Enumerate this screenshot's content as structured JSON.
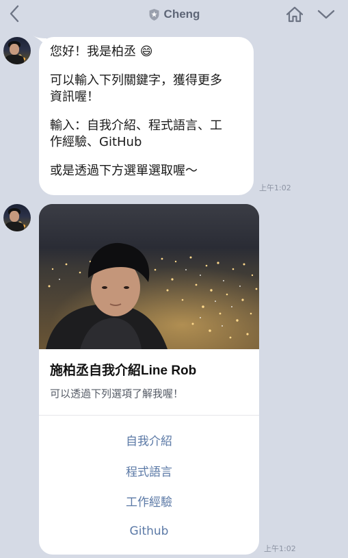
{
  "header": {
    "title": "Cheng",
    "back_icon": "chevron-left-icon",
    "badge_icon": "official-badge-icon",
    "home_icon": "home-icon",
    "menu_icon": "chevron-down-icon"
  },
  "messages": [
    {
      "type": "text",
      "lines": [
        "您好！我是柏丞 😄",
        "",
        "可以輸入下列關鍵字，獲得更多",
        "資訊喔！",
        "",
        "輸入：自我介紹、程式語言、工",
        "作經驗、GitHub",
        "",
        "或是透過下方選單選取喔～"
      ],
      "time": "上午1:02"
    },
    {
      "type": "card",
      "title": "施柏丞自我介紹Line Rob",
      "subtitle": "可以透過下列選項了解我喔！",
      "actions": [
        "自我介紹",
        "程式語言",
        "工作經驗",
        "Github"
      ],
      "time": "上午1:02"
    }
  ],
  "colors": {
    "background": "#d5dae5",
    "header_text": "#5e6677",
    "link": "#5b79a6",
    "timestamp": "#8c93a3"
  }
}
